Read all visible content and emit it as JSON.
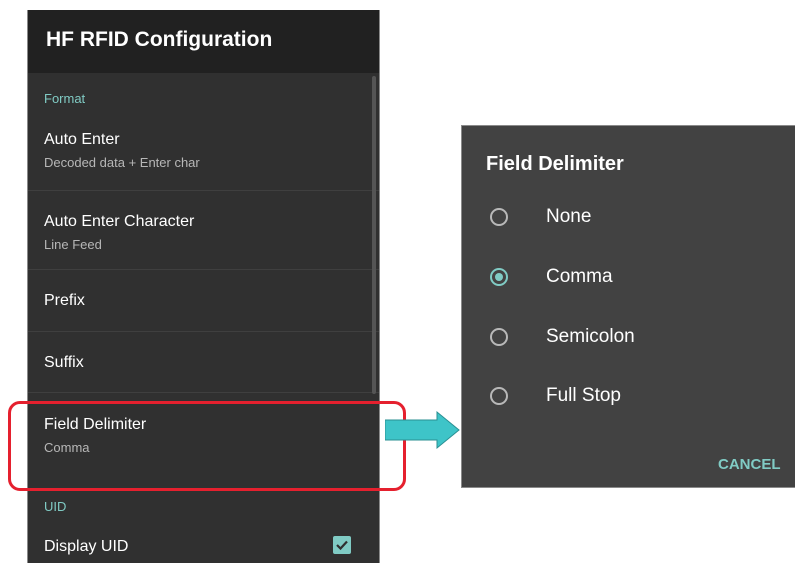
{
  "settings": {
    "title": "HF RFID Configuration",
    "sections": {
      "format": "Format",
      "uid": "UID"
    },
    "items": [
      {
        "title": "Auto Enter",
        "summary": "Decoded data + Enter char"
      },
      {
        "title": "Auto Enter Character",
        "summary": "Line Feed"
      },
      {
        "title": "Prefix"
      },
      {
        "title": "Suffix"
      },
      {
        "title": "Field Delimiter",
        "summary": "Comma"
      },
      {
        "title": "Display UID",
        "checked": true
      }
    ]
  },
  "dialog": {
    "title": "Field Delimiter",
    "options": [
      "None",
      "Comma",
      "Semicolon",
      "Full Stop"
    ],
    "selected": "Comma",
    "cancel_label": "CANCEL"
  },
  "colors": {
    "accent": "#80cbc4",
    "highlight": "#e5202e",
    "arrow": "#3ec4c8"
  }
}
